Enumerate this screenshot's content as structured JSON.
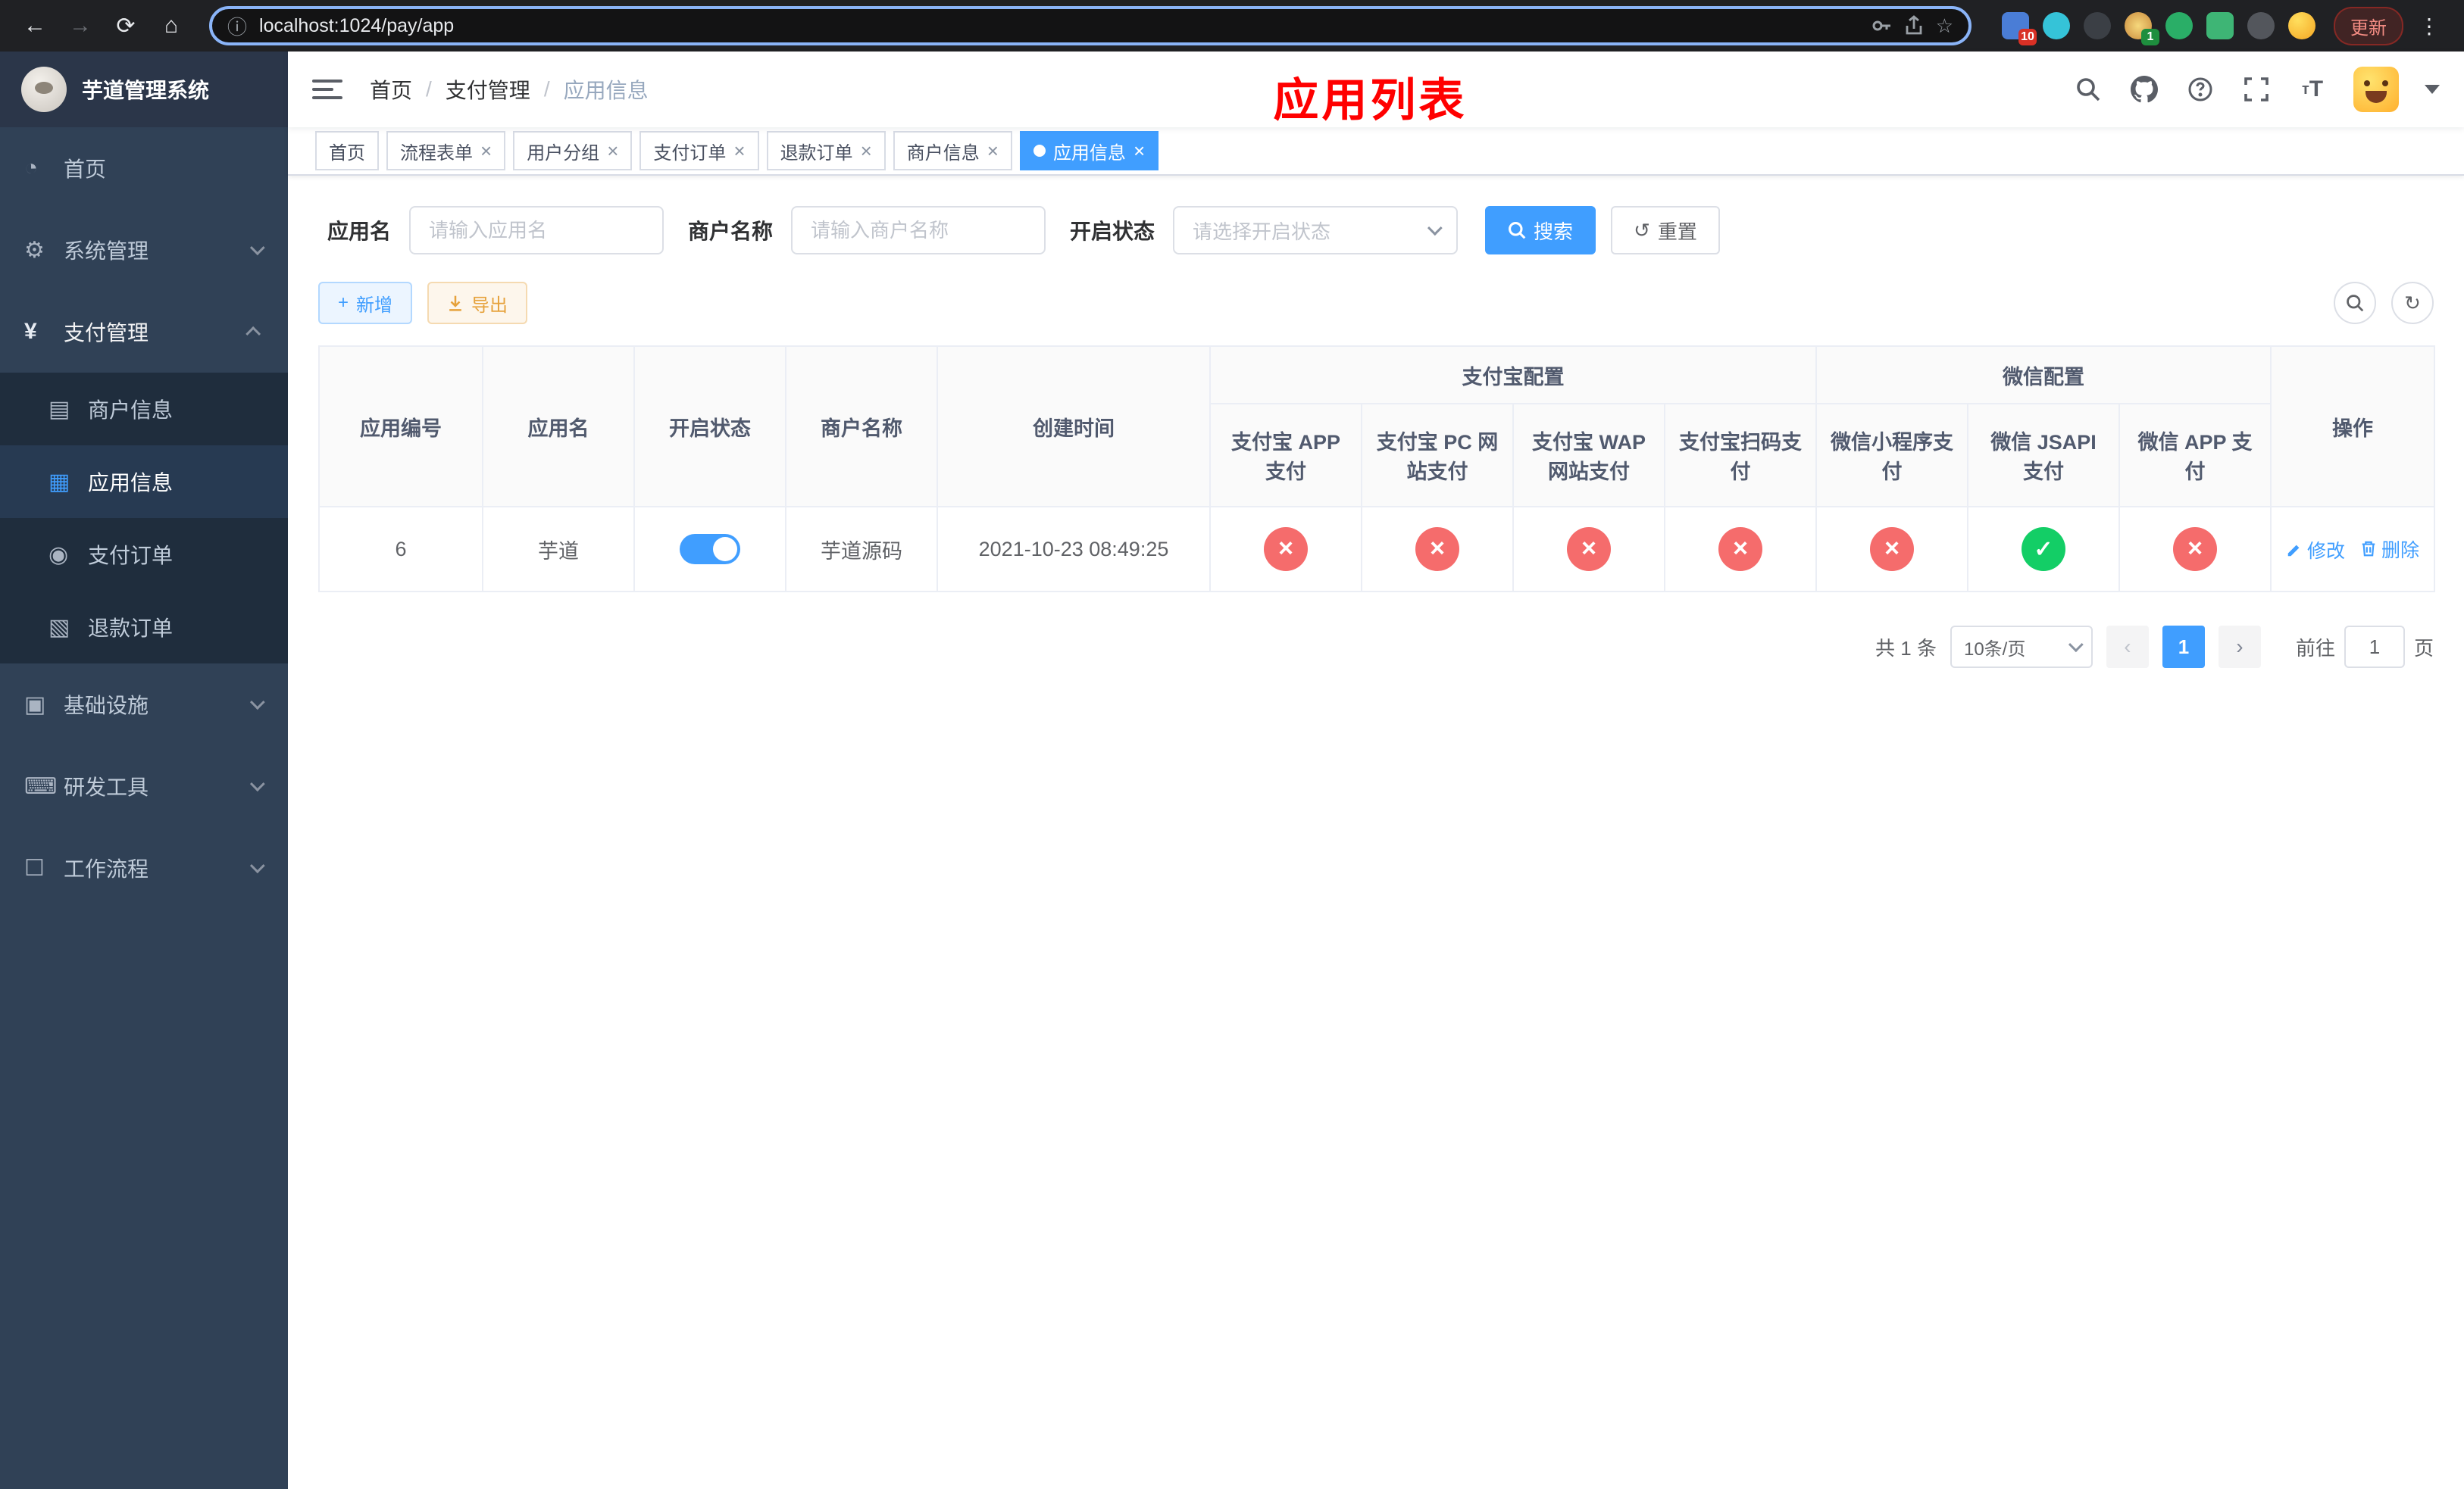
{
  "browser": {
    "url": "localhost:1024/pay/app",
    "update_label": "更新",
    "ext_badge_blue": "10",
    "ext_badge_green": "1"
  },
  "sidebar": {
    "title": "芋道管理系统",
    "items": [
      {
        "label": "首页"
      },
      {
        "label": "系统管理"
      },
      {
        "label": "支付管理"
      },
      {
        "label": "基础设施"
      },
      {
        "label": "研发工具"
      },
      {
        "label": "工作流程"
      }
    ],
    "payment_children": [
      {
        "label": "商户信息"
      },
      {
        "label": "应用信息"
      },
      {
        "label": "支付订单"
      },
      {
        "label": "退款订单"
      }
    ]
  },
  "header": {
    "breadcrumb": [
      "首页",
      "支付管理",
      "应用信息"
    ],
    "annotation": "应用列表"
  },
  "tabs": [
    {
      "label": "首页"
    },
    {
      "label": "流程表单"
    },
    {
      "label": "用户分组"
    },
    {
      "label": "支付订单"
    },
    {
      "label": "退款订单"
    },
    {
      "label": "商户信息"
    },
    {
      "label": "应用信息"
    }
  ],
  "filters": {
    "app_name_label": "应用名",
    "app_name_placeholder": "请输入应用名",
    "merchant_label": "商户名称",
    "merchant_placeholder": "请输入商户名称",
    "status_label": "开启状态",
    "status_placeholder": "请选择开启状态",
    "search_label": "搜索",
    "reset_label": "重置"
  },
  "toolbar": {
    "add_label": "新增",
    "export_label": "导出"
  },
  "table": {
    "columns": {
      "id": "应用编号",
      "name": "应用名",
      "status": "开启状态",
      "merchant": "商户名称",
      "created": "创建时间",
      "alipay_group": "支付宝配置",
      "wechat_group": "微信配置",
      "alipay_app": "支付宝 APP 支付",
      "alipay_pc": "支付宝 PC 网站支付",
      "alipay_wap": "支付宝 WAP 网站支付",
      "alipay_qr": "支付宝扫码支付",
      "wx_mini": "微信小程序支付",
      "wx_jsapi": "微信 JSAPI 支付",
      "wx_app": "微信 APP 支付",
      "ops": "操作"
    },
    "row": {
      "id": "6",
      "name": "芋道",
      "status_on": true,
      "merchant": "芋道源码",
      "created": "2021-10-23 08:49:25",
      "configs": [
        false,
        false,
        false,
        false,
        false,
        true,
        false
      ],
      "edit_label": "修改",
      "delete_label": "删除"
    }
  },
  "pagination": {
    "total_label": "共 1 条",
    "page_size": "10条/页",
    "current_page": "1",
    "goto_label": "前往",
    "goto_value": "1",
    "unit_label": "页"
  },
  "colors": {
    "accent": "#409eff",
    "danger": "#f56c6c",
    "success": "#13ce66"
  }
}
